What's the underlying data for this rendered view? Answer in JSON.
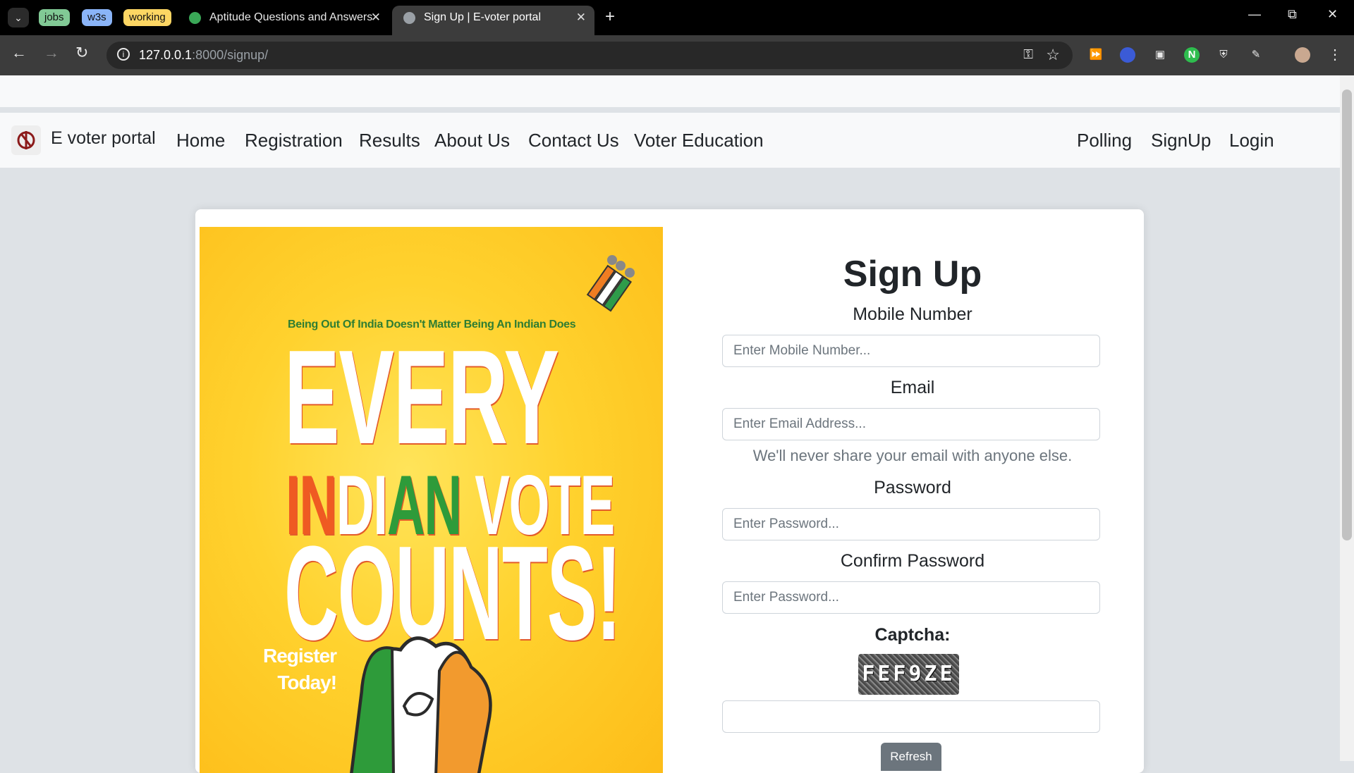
{
  "browser": {
    "tab_groups": [
      {
        "label": "jobs",
        "color": "#81c995"
      },
      {
        "label": "w3s",
        "color": "#8ab4f8"
      },
      {
        "label": "working",
        "color": "#fdd663"
      }
    ],
    "tabs": [
      {
        "title": "Aptitude Questions and Answers"
      },
      {
        "title": "Sign Up | E-voter portal"
      }
    ],
    "url_host": "127.0.0.1",
    "url_path": ":8000/signup/"
  },
  "navbar": {
    "brand": "E voter portal",
    "links": [
      "Home",
      "Registration",
      "Results",
      "About Us",
      "Contact Us",
      "Voter Education"
    ],
    "right_links": [
      "Polling",
      "SignUp",
      "Login"
    ]
  },
  "poster": {
    "tagline": "Being Out Of India Doesn't Matter Being An Indian Does",
    "line1": "EVERY",
    "line2_a": "IN",
    "line2_b": "DI",
    "line2_c": "AN",
    "line2_d": " VOTE",
    "line3": "COUNTS!",
    "register_1": "Register",
    "register_2": "Today!"
  },
  "form": {
    "title": "Sign Up",
    "mobile_label": "Mobile Number",
    "mobile_placeholder": "Enter Mobile Number...",
    "email_label": "Email",
    "email_placeholder": "Enter Email Address...",
    "email_help": "We'll never share your email with anyone else.",
    "password_label": "Password",
    "password_placeholder": "Enter Password...",
    "confirm_label": "Confirm Password",
    "confirm_placeholder": "Enter Password...",
    "captcha_label": "Captcha:",
    "captcha_text": "FEF9ZE",
    "captcha_value": "",
    "refresh_label": "Refresh"
  }
}
